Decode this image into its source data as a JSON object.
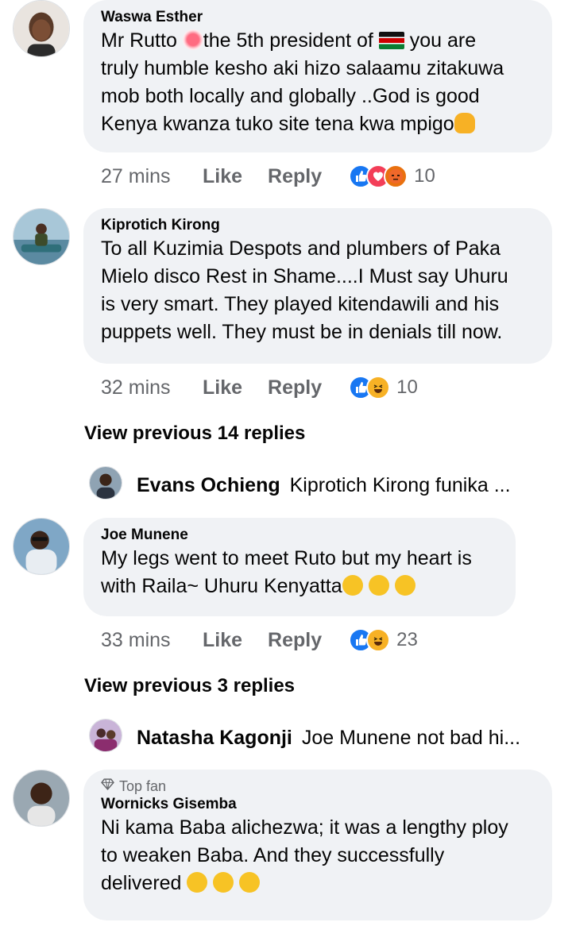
{
  "comments": [
    {
      "author": "Waswa Esther",
      "line1_a": "Mr Rutto ",
      "line1_b": "the 5th president of ",
      "line1_c": " you are",
      "line2": "truly humble kesho aki hizo salaamu zitakuwa",
      "line3": "mob both locally and globally ..God is good",
      "line4": "Kenya kwanza tuko site tena kwa mpigo",
      "time": "27 mins",
      "like": "Like",
      "reply": "Reply",
      "reaction_count": "10"
    },
    {
      "author": "Kiprotich Kirong",
      "line1": "To all Kuzimia Despots and plumbers of Paka",
      "line2": "Mielo disco Rest in Shame....I Must say Uhuru",
      "line3": "is very smart.  They played kitendawili and his",
      "line4": "puppets well. They must be in denials till now.",
      "time": "32 mins",
      "like": "Like",
      "reply": "Reply",
      "reaction_count": "10"
    },
    {
      "author": "Joe Munene",
      "line1": "My legs went to meet Ruto but my heart is",
      "line2": "with Raila~ Uhuru Kenyatta",
      "time": "33 mins",
      "like": "Like",
      "reply": "Reply",
      "reaction_count": "23"
    },
    {
      "badge": "Top fan",
      "author": "Wornicks Gisemba",
      "line1": "Ni kama Baba alichezwa; it was a lengthy ploy",
      "line2": "to weaken Baba. And they successfully",
      "line3": "delivered "
    }
  ],
  "view_previous": [
    "View previous 14 replies",
    "View previous 3 replies"
  ],
  "reply_previews": [
    {
      "name": "Evans Ochieng",
      "text": "Kiprotich Kirong funika ..."
    },
    {
      "name": "Natasha Kagonji",
      "text": "Joe Munene not bad hi..."
    }
  ],
  "colors": {
    "like_blue": "#1877f2",
    "love_red": "#f33e58",
    "haha_yellow": "#f7b125",
    "bubble_bg": "#f0f2f5",
    "meta_gray": "#65676b"
  },
  "icons": {
    "like": "thumbs-up-icon",
    "love": "heart-icon",
    "angry": "angry-face-icon",
    "haha": "laughing-face-icon",
    "top_fan": "diamond-icon"
  }
}
